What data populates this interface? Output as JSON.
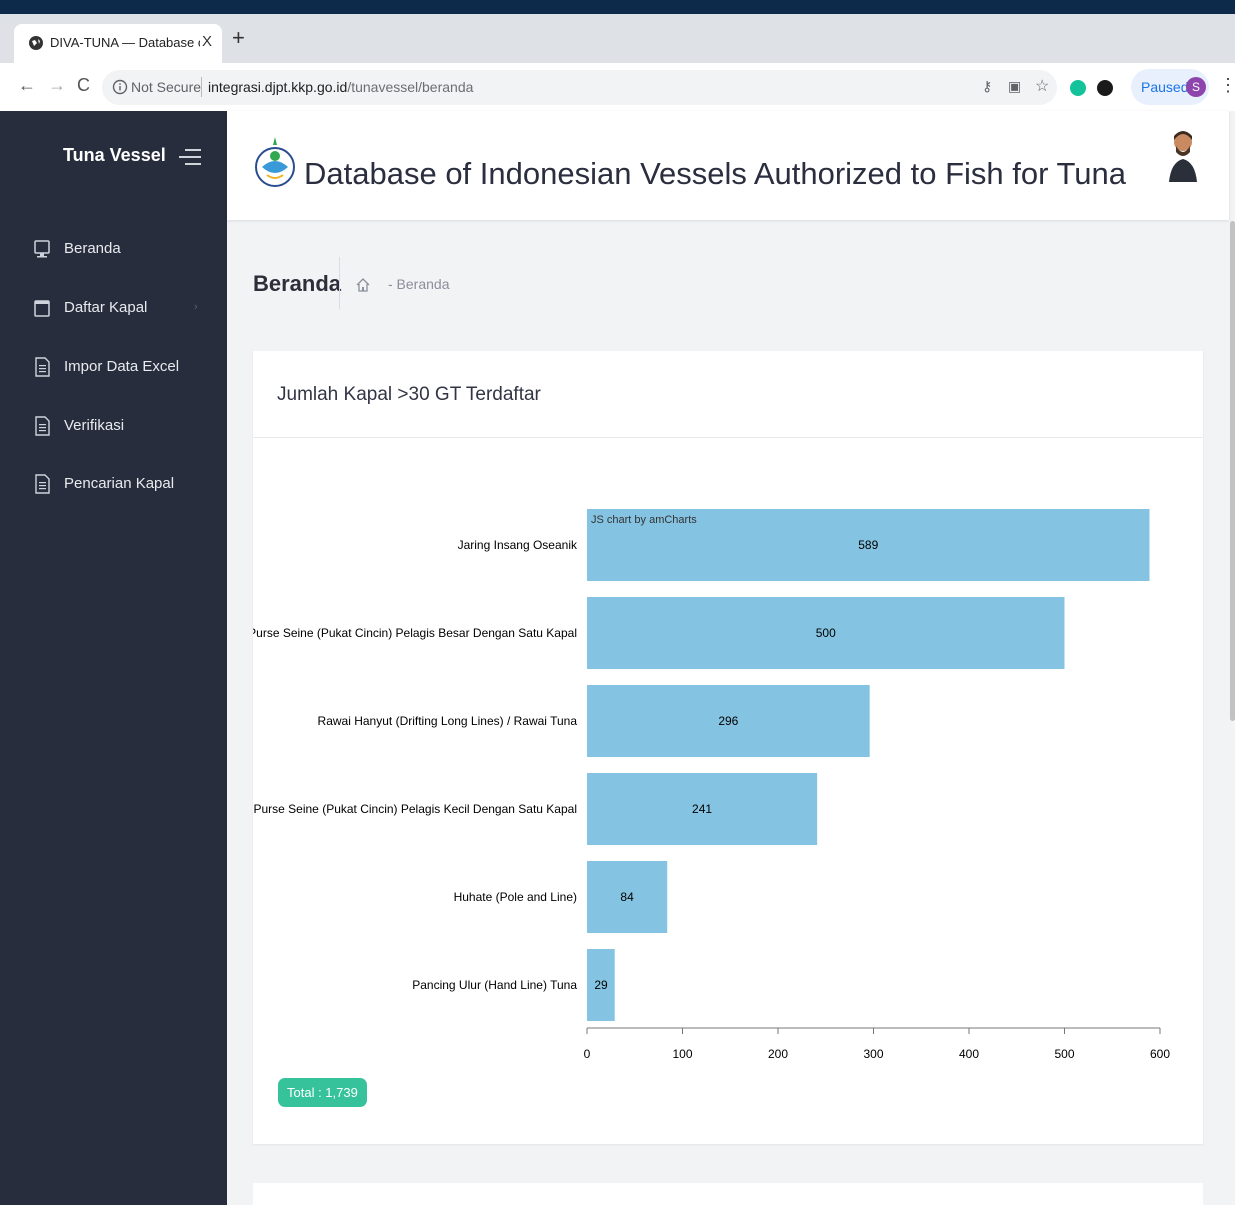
{
  "browser": {
    "tab_title": "DIVA-TUNA — Database of Ind",
    "tab_close": "X",
    "new_tab": "+",
    "security_label": "Not Secure",
    "url_host": "integrasi.djpt.kkp.go.id",
    "url_path": "/tunavessel/beranda",
    "profile_status": "Paused",
    "profile_initial": "S",
    "back": "←",
    "forward": "→",
    "reload": "C",
    "menu": "⋮",
    "icons": [
      "key-icon",
      "translate-icon",
      "star-icon",
      "grammarly-icon",
      "shield-icon"
    ]
  },
  "sidebar": {
    "brand": "Tuna Vessel",
    "items": [
      {
        "label": "Beranda",
        "icon": "monitor-icon"
      },
      {
        "label": "Daftar Kapal",
        "icon": "folder-icon",
        "chevron": "›"
      },
      {
        "label": "Impor Data Excel",
        "icon": "document-icon"
      },
      {
        "label": "Verifikasi",
        "icon": "document-icon"
      },
      {
        "label": "Pencarian Kapal",
        "icon": "document-icon"
      }
    ]
  },
  "header": {
    "title": "Database of Indonesian Vessels Authorized to Fish for Tuna"
  },
  "page": {
    "heading": "Beranda",
    "breadcrumb": "- Beranda"
  },
  "card": {
    "title": "Jumlah Kapal >30 GT Terdaftar",
    "total": "Total : 1,739"
  },
  "chart_data": {
    "type": "bar",
    "orientation": "horizontal",
    "watermark": "JS chart by amCharts",
    "categories": [
      "Jaring Insang Oseanik",
      "Purse Seine (Pukat Cincin) Pelagis Besar Dengan Satu Kapal",
      "Rawai Hanyut (Drifting Long Lines) / Rawai Tuna",
      "Purse Seine (Pukat Cincin) Pelagis Kecil Dengan Satu Kapal",
      "Huhate (Pole and Line)",
      "Pancing Ulur (Hand Line) Tuna"
    ],
    "values": [
      589,
      500,
      296,
      241,
      84,
      29
    ],
    "xlim": [
      0,
      600
    ],
    "ticks": [
      0,
      100,
      200,
      300,
      400,
      500,
      600
    ],
    "bar_color": "#84c4e2",
    "grid": false
  }
}
